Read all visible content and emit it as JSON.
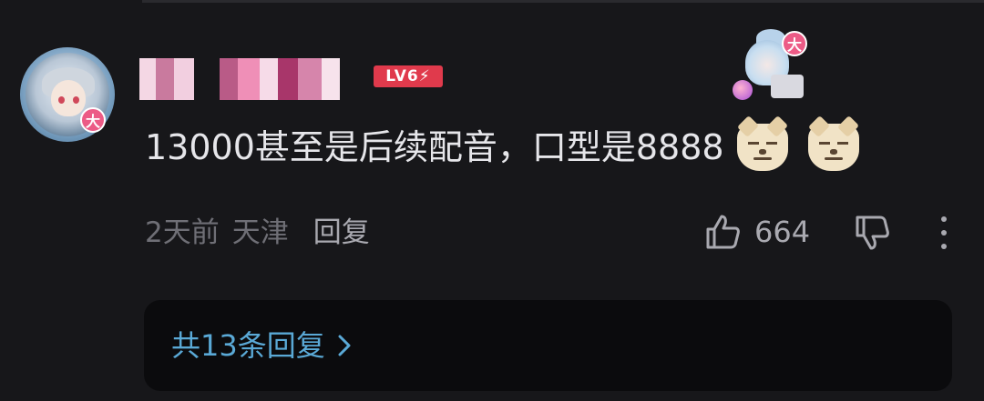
{
  "comment": {
    "level_badge": "LV6",
    "user_badge": "大",
    "text": "13000甚至是后续配音，口型是8888",
    "emotes": [
      "dog-emote-icon",
      "dog-emote-icon"
    ],
    "time": "2天前",
    "location": "天津",
    "reply_label": "回复",
    "like_count": "664"
  },
  "replies": {
    "label": "共13条回复"
  },
  "colors": {
    "background": "#17171a",
    "level_badge": "#e03a4c",
    "link": "#5aa9d6",
    "user_badge": "#ec5b86"
  }
}
